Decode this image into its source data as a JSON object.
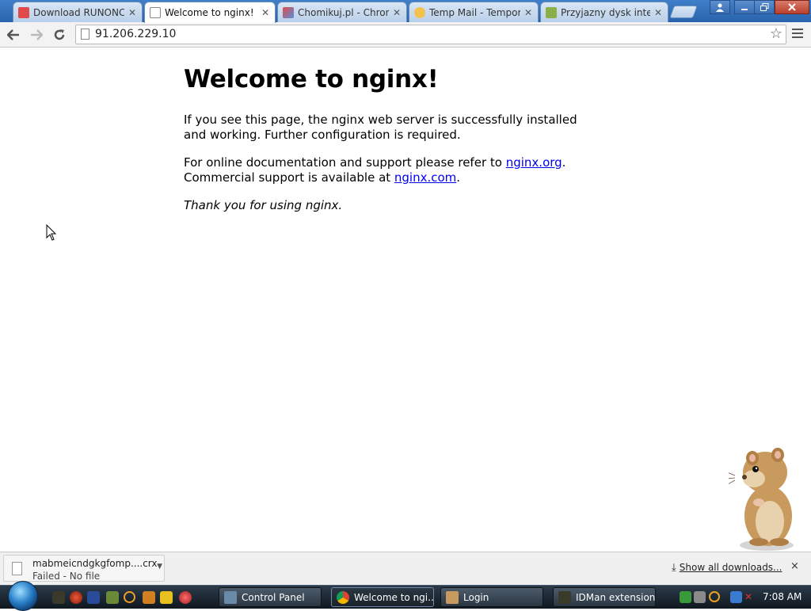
{
  "tabs": [
    {
      "title": "Download RUNONCE",
      "active": false,
      "favicon": "runonce-favicon",
      "color": "#e04a4a"
    },
    {
      "title": "Welcome to nginx!",
      "active": true,
      "favicon": "page-icon",
      "color": "#ffffff"
    },
    {
      "title": "Chomikuj.pl - Chrom",
      "active": false,
      "favicon": "chomikuj-favicon",
      "color": "#5a8fd8"
    },
    {
      "title": "Temp Mail - Tempor",
      "active": false,
      "favicon": "tempmail-favicon",
      "color": "#f2c14e"
    },
    {
      "title": "Przyjazny dysk intern",
      "active": false,
      "favicon": "chomik-favicon",
      "color": "#8ab04a"
    }
  ],
  "toolbar": {
    "url": "91.206.229.10",
    "back_icon": "back-arrow-icon",
    "forward_icon": "forward-arrow-icon",
    "reload_icon": "reload-icon",
    "star_icon": "bookmark-star-icon",
    "menu_icon": "chrome-menu-icon"
  },
  "page": {
    "heading": "Welcome to nginx!",
    "para1": "If you see this page, the nginx web server is successfully installed and working. Further configuration is required.",
    "para2_prefix": "For online documentation and support please refer to ",
    "link1": "nginx.org",
    "para2_mid": ".",
    "para2_line2": "Commercial support is available at ",
    "link2": "nginx.com",
    "para2_end": ".",
    "thanks": "Thank you for using nginx."
  },
  "downloads": {
    "filename": "mabmeicndgkgfomp....crx",
    "status": "Failed - No file",
    "show_all": "Show all downloads...",
    "close": "×"
  },
  "taskbar": {
    "buttons": [
      {
        "label": "Control Panel",
        "active": false
      },
      {
        "label": "Welcome to ngi...",
        "active": true
      },
      {
        "label": "Login",
        "active": false
      },
      {
        "label": "IDMan extension...",
        "active": false
      }
    ],
    "clock": "7:08 AM"
  },
  "window_controls": {
    "user": "user-icon",
    "minimize": "minimize-icon",
    "restore": "restore-icon",
    "close": "close-icon"
  },
  "colors": {
    "link": "#0000ee",
    "titlebar": "#2a63ad",
    "taskbar": "#1a232b"
  }
}
